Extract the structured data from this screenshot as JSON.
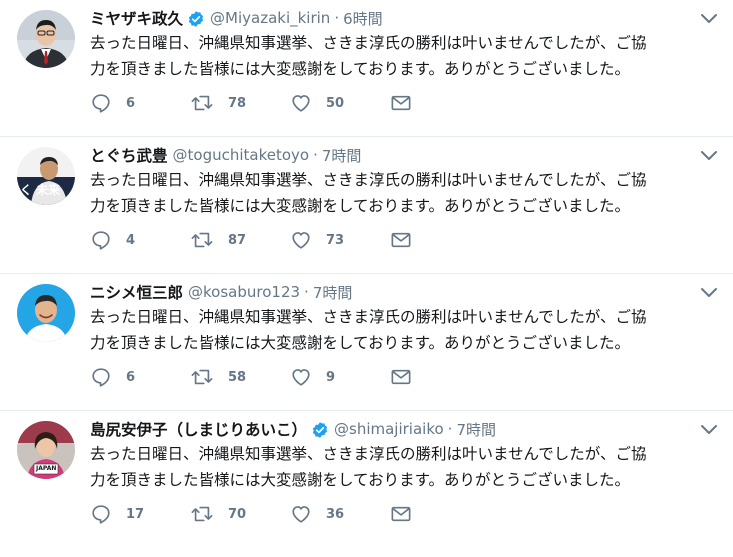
{
  "tweets": [
    {
      "name": "ミヤザキ政久",
      "verified": true,
      "handle": "@Miyazaki_kirin",
      "time": "6時間",
      "text": "去った日曜日、沖縄県知事選挙、さきま淳氏の勝利は叶いませんでしたが、ご協\n力を頂きました皆様には大変感謝をしております。ありがとうございました。",
      "replies": "6",
      "retweets": "78",
      "likes": "50",
      "avatar_icon": "man-in-suit-avatar"
    },
    {
      "name": "とぐち武豊",
      "verified": false,
      "handle": "@toguchitaketoyo",
      "time": "7時間",
      "text": "去った日曜日、沖縄県知事選挙、さきま淳氏の勝利は叶いませんでしたが、ご協\n力を頂きました皆様には大変感謝をしております。ありがとうございました。",
      "replies": "4",
      "retweets": "87",
      "likes": "73",
      "avatar_icon": "man-with-banner-avatar",
      "avatar_text": "く 未来"
    },
    {
      "name": "ニシメ恒三郎",
      "verified": false,
      "handle": "@kosaburo123",
      "time": "7時間",
      "text": "去った日曜日、沖縄県知事選挙、さきま淳氏の勝利は叶いませんでしたが、ご協\n力を頂きました皆様には大変感謝をしております。ありがとうございました。",
      "replies": "6",
      "retweets": "58",
      "likes": "9",
      "avatar_icon": "smiling-man-blue-background-avatar"
    },
    {
      "name": "島尻安伊子（しまじりあいこ）",
      "verified": true,
      "handle": "@shimajiriaiko",
      "time": "7時間",
      "text": "去った日曜日、沖縄県知事選挙、さきま淳氏の勝利は叶いませんでしたが、ご協\n力を頂きました皆様には大変感謝をしております。ありがとうございました。",
      "replies": "17",
      "retweets": "70",
      "likes": "36",
      "avatar_icon": "woman-with-japan-sign-avatar",
      "avatar_text": "JAPAN"
    }
  ],
  "separator": " · ",
  "colors": {
    "text": "#14171a",
    "muted": "#657786",
    "verified": "#1da1f2",
    "border": "#e6ecf0"
  }
}
